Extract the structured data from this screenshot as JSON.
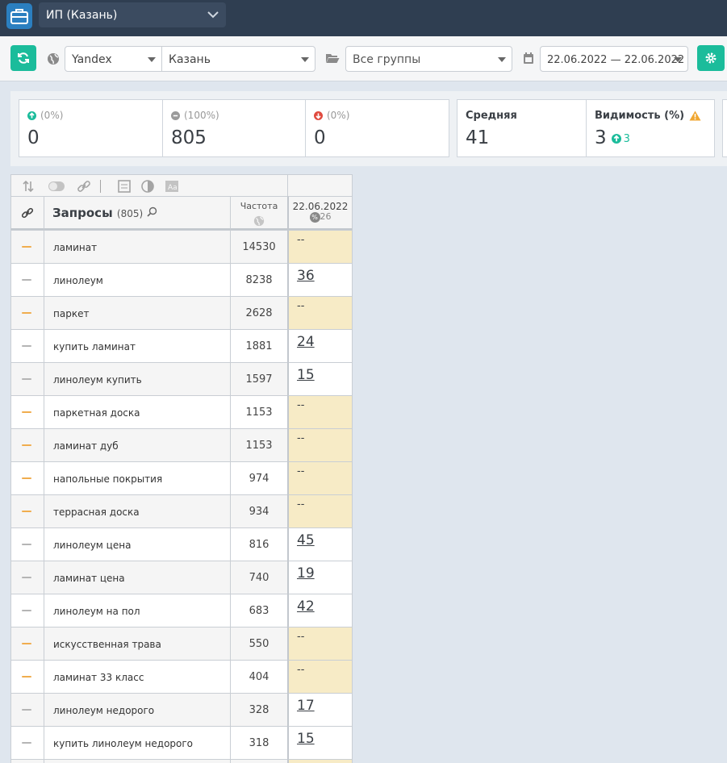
{
  "project": {
    "name": "ИП (Казань)"
  },
  "filters": {
    "engine": "Yandex",
    "city": "Казань",
    "group": "Все группы",
    "date_range": "22.06.2022 — 22.06.2022"
  },
  "stats": {
    "up": {
      "percent": "(0%)",
      "value": "0"
    },
    "same": {
      "percent": "(100%)",
      "value": "805"
    },
    "down": {
      "percent": "(0%)",
      "value": "0"
    },
    "average": {
      "label": "Средняя",
      "value": "41"
    },
    "visibility": {
      "label": "Видимость (%)",
      "value": "3",
      "delta": "3"
    }
  },
  "table": {
    "queries_label": "Запросы",
    "queries_count": "(805)",
    "freq_label": "Частота",
    "date_col": "22.06.2022",
    "date_percent": "26",
    "rows": [
      {
        "query": "ламинат",
        "freq": "14530",
        "pos": "--"
      },
      {
        "query": "линолеум",
        "freq": "8238",
        "pos": "36"
      },
      {
        "query": "паркет",
        "freq": "2628",
        "pos": "--"
      },
      {
        "query": "купить ламинат",
        "freq": "1881",
        "pos": "24"
      },
      {
        "query": "линолеум купить",
        "freq": "1597",
        "pos": "15"
      },
      {
        "query": "паркетная доска",
        "freq": "1153",
        "pos": "--"
      },
      {
        "query": "ламинат дуб",
        "freq": "1153",
        "pos": "--"
      },
      {
        "query": "напольные покрытия",
        "freq": "974",
        "pos": "--"
      },
      {
        "query": "террасная доска",
        "freq": "934",
        "pos": "--"
      },
      {
        "query": "линолеум цена",
        "freq": "816",
        "pos": "45"
      },
      {
        "query": "ламинат цена",
        "freq": "740",
        "pos": "19"
      },
      {
        "query": "линолеум на пол",
        "freq": "683",
        "pos": "42"
      },
      {
        "query": "искусственная трава",
        "freq": "550",
        "pos": "--"
      },
      {
        "query": "ламинат 33 класс",
        "freq": "404",
        "pos": "--"
      },
      {
        "query": "линолеум недорого",
        "freq": "328",
        "pos": "17"
      },
      {
        "query": "купить линолеум недорого",
        "freq": "318",
        "pos": "15"
      },
      {
        "query": "",
        "freq": "",
        "pos": ""
      }
    ]
  },
  "colors": {
    "accent": "#1bbc9b",
    "topbar": "#2f3e51",
    "no_position_bg": "#f7ebc6",
    "marker_orange": "#f0ad4e",
    "marker_gray": "#b5b5b5"
  }
}
